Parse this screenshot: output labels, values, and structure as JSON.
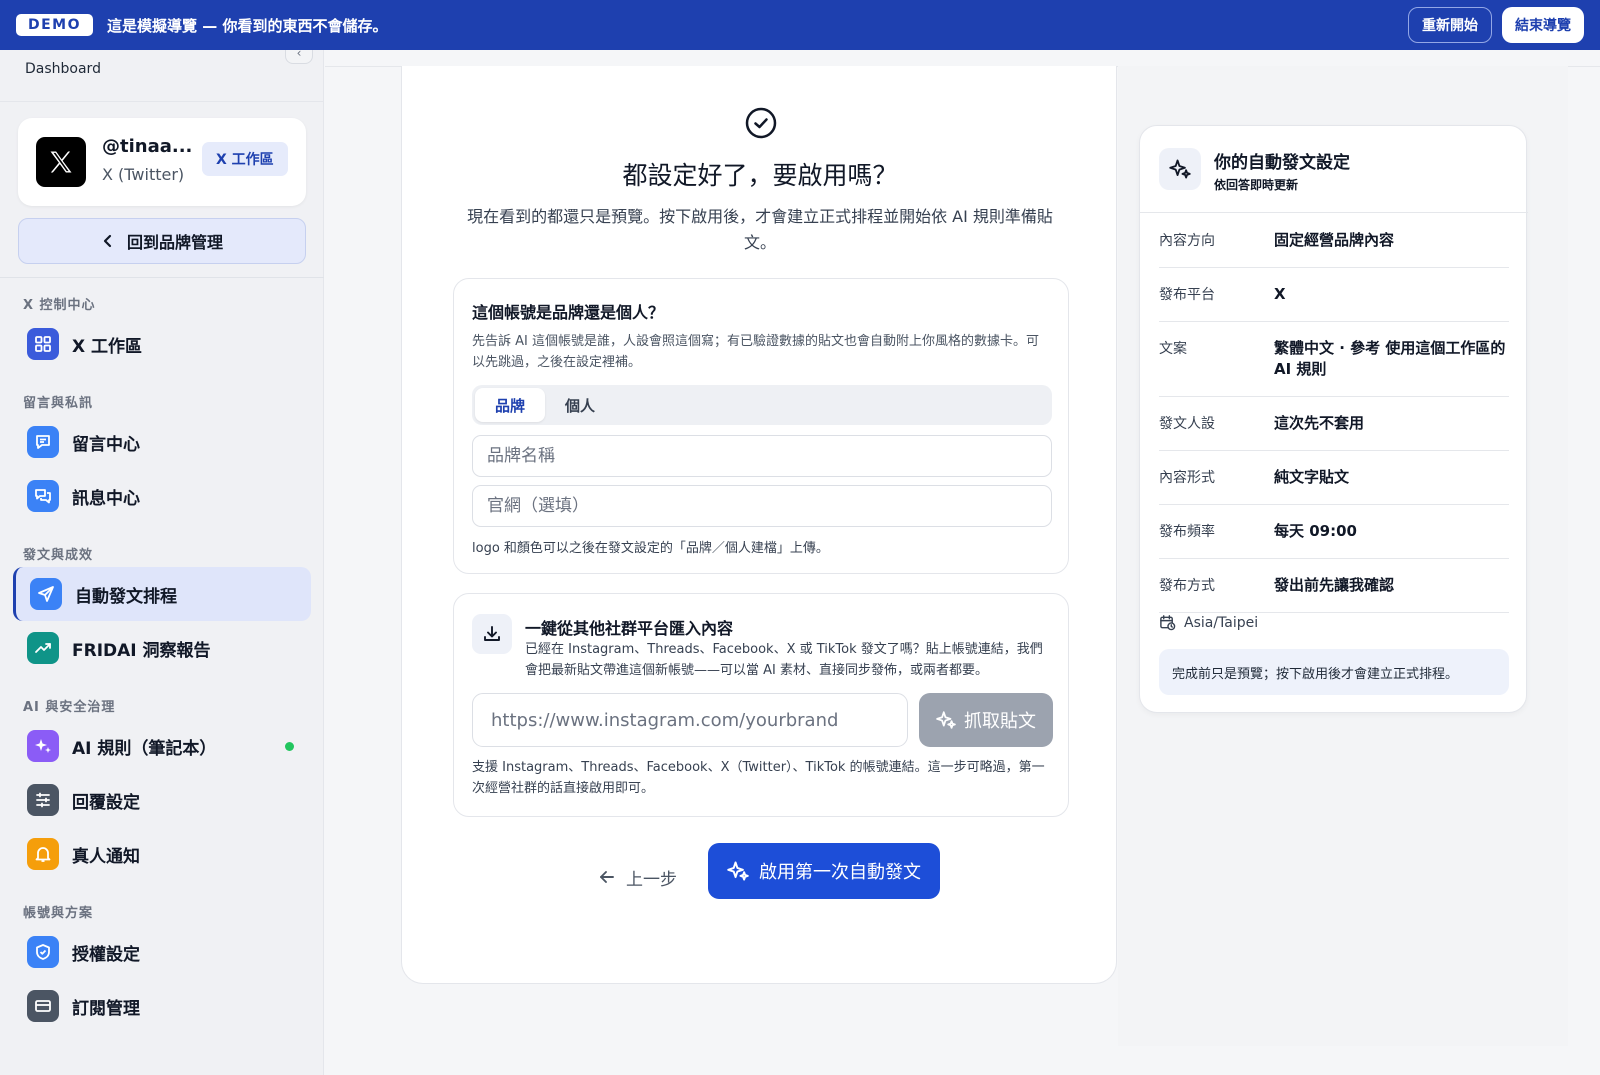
{
  "banner": {
    "badge": "DEMO",
    "text": "這是模擬導覽 — 你看到的東西不會儲存。",
    "restart_label": "重新開始",
    "end_label": "結束導覽"
  },
  "sidebar": {
    "dashboard_label": "Dashboard",
    "account": {
      "handle": "@tinaa...",
      "platform": "X (Twitter)",
      "workspace_tag": "X 工作區"
    },
    "back_label": "回到品牌管理",
    "sections": [
      {
        "title": "X 控制中心",
        "items": [
          {
            "label": "X 工作區",
            "icon": "grid-icon",
            "color": "#3b5bdb"
          }
        ]
      },
      {
        "title": "留言與私訊",
        "items": [
          {
            "label": "留言中心",
            "icon": "comment-icon",
            "color": "#3b82f6"
          },
          {
            "label": "訊息中心",
            "icon": "chat-icon",
            "color": "#3b82f6"
          }
        ]
      },
      {
        "title": "發文與成效",
        "items": [
          {
            "label": "自動發文排程",
            "icon": "send-icon",
            "color": "#3b82f6",
            "active": true
          },
          {
            "label": "FRIDAI 洞察報告",
            "icon": "trend-icon",
            "color": "#0f9488"
          }
        ]
      },
      {
        "title": "AI 與安全治理",
        "items": [
          {
            "label": "AI 規則（筆記本）",
            "icon": "sparkle-icon",
            "color": "#8b5cf6",
            "status": "active"
          },
          {
            "label": "回覆設定",
            "icon": "sliders-icon",
            "color": "#4b5563"
          },
          {
            "label": "真人通知",
            "icon": "bell-icon",
            "color": "#f59e0b"
          }
        ]
      },
      {
        "title": "帳號與方案",
        "items": [
          {
            "label": "授權設定",
            "icon": "shield-icon",
            "color": "#3b82f6"
          },
          {
            "label": "訂閱管理",
            "icon": "card-icon",
            "color": "#4b5563"
          }
        ]
      }
    ]
  },
  "wizard": {
    "title": "都設定好了，要啟用嗎？",
    "description": "現在看到的都還只是預覽。按下啟用後，才會建立正式排程並開始依 AI 規則準備貼文。",
    "identity": {
      "title": "這個帳號是品牌還是個人？",
      "description": "先告訴 AI 這個帳號是誰，人設會照這個寫；有已驗證數據的貼文也會自動附上你風格的數據卡。可以先跳過，之後在設定裡補。",
      "tab_brand": "品牌",
      "tab_personal": "個人",
      "brand_name_placeholder": "品牌名稱",
      "website_placeholder": "官網（選填）",
      "note": "logo 和顏色可以之後在發文設定的「品牌／個人建檔」上傳。"
    },
    "import": {
      "title": "一鍵從其他社群平台匯入內容",
      "description": "已經在 Instagram、Threads、Facebook、X 或 TikTok 發文了嗎？貼上帳號連結，我們會把最新貼文帶進這個新帳號——可以當 AI 素材、直接同步發佈，或兩者都要。",
      "url_placeholder": "https://www.instagram.com/yourbrand",
      "fetch_label": "抓取貼文",
      "note": "支援 Instagram、Threads、Facebook、X（Twitter）、TikTok 的帳號連結。這一步可略過，第一次經營社群的話直接啟用即可。"
    },
    "prev_label": "上一步",
    "enable_label": "啟用第一次自動發文"
  },
  "summary": {
    "title": "你的自動發文設定",
    "subtitle": "依回答即時更新",
    "rows": [
      {
        "key": "內容方向",
        "value": "固定經營品牌內容"
      },
      {
        "key": "發布平台",
        "value": "X"
      },
      {
        "key": "文案",
        "value": "繁體中文 · 參考 使用這個工作區的 AI 規則"
      },
      {
        "key": "發文人設",
        "value": "這次先不套用"
      },
      {
        "key": "內容形式",
        "value": "純文字貼文"
      },
      {
        "key": "發布頻率",
        "value": "每天 09:00"
      },
      {
        "key": "發布方式",
        "value": "發出前先讓我確認"
      }
    ],
    "timezone": "Asia/Taipei",
    "note": "完成前只是預覽；按下啟用後才會建立正式排程。"
  }
}
